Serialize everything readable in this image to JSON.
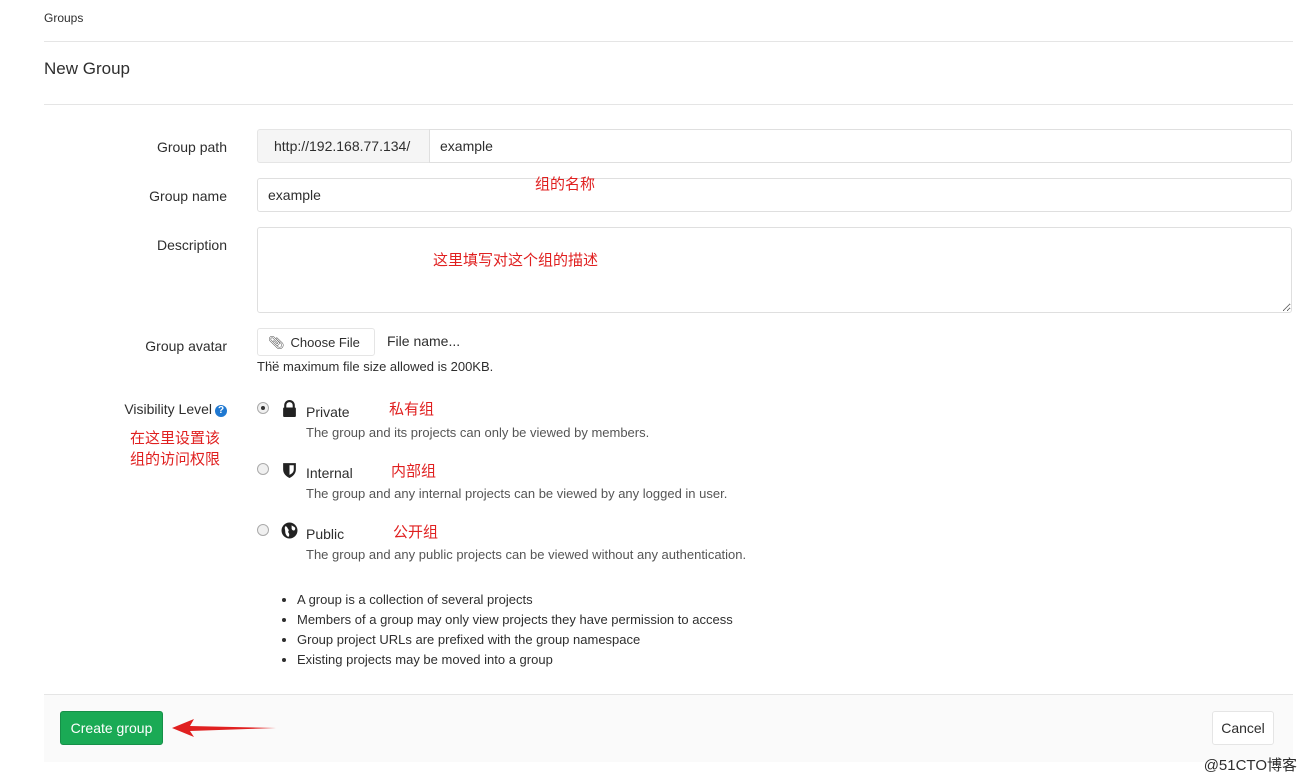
{
  "breadcrumb": "Groups",
  "page_title": "New Group",
  "form": {
    "group_path": {
      "label": "Group path",
      "prefix": "http://192.168.77.134/",
      "value": "example"
    },
    "group_name": {
      "label": "Group name",
      "value": "example"
    },
    "description": {
      "label": "Description",
      "value": ""
    },
    "avatar": {
      "label": "Group avatar",
      "button_label": "Choose File ...",
      "file_name": "File name...",
      "hint": "The maximum file size allowed is 200KB."
    },
    "visibility": {
      "label": "Visibility Level",
      "help_icon": "?",
      "options": [
        {
          "title": "Private",
          "description": "The group and its projects can only be viewed by members.",
          "icon": "lock-icon",
          "selected": true
        },
        {
          "title": "Internal",
          "description": "The group and any internal projects can be viewed by any logged in user.",
          "icon": "shield-icon",
          "selected": false
        },
        {
          "title": "Public",
          "description": "The group and any public projects can be viewed without any authentication.",
          "icon": "globe-icon",
          "selected": false
        }
      ]
    }
  },
  "info_list": [
    "A group is a collection of several projects",
    "Members of a group may only view projects they have permission to access",
    "Group project URLs are prefixed with the group namespace",
    "Existing projects may be moved into a group"
  ],
  "buttons": {
    "create": "Create group",
    "cancel": "Cancel"
  },
  "annotations": {
    "group_name_note": "组的名称",
    "description_note": "这里填写对这个组的描述",
    "visibility_note_line1": "在这里设置该",
    "visibility_note_line2": "组的访问权限",
    "private_note": "私有组",
    "internal_note": "内部组",
    "public_note": "公开组"
  },
  "watermark": "@51CTO博客",
  "colors": {
    "primary_button": "#1aaa55",
    "annotation": "#e02020",
    "help_icon": "#1f78d1"
  }
}
